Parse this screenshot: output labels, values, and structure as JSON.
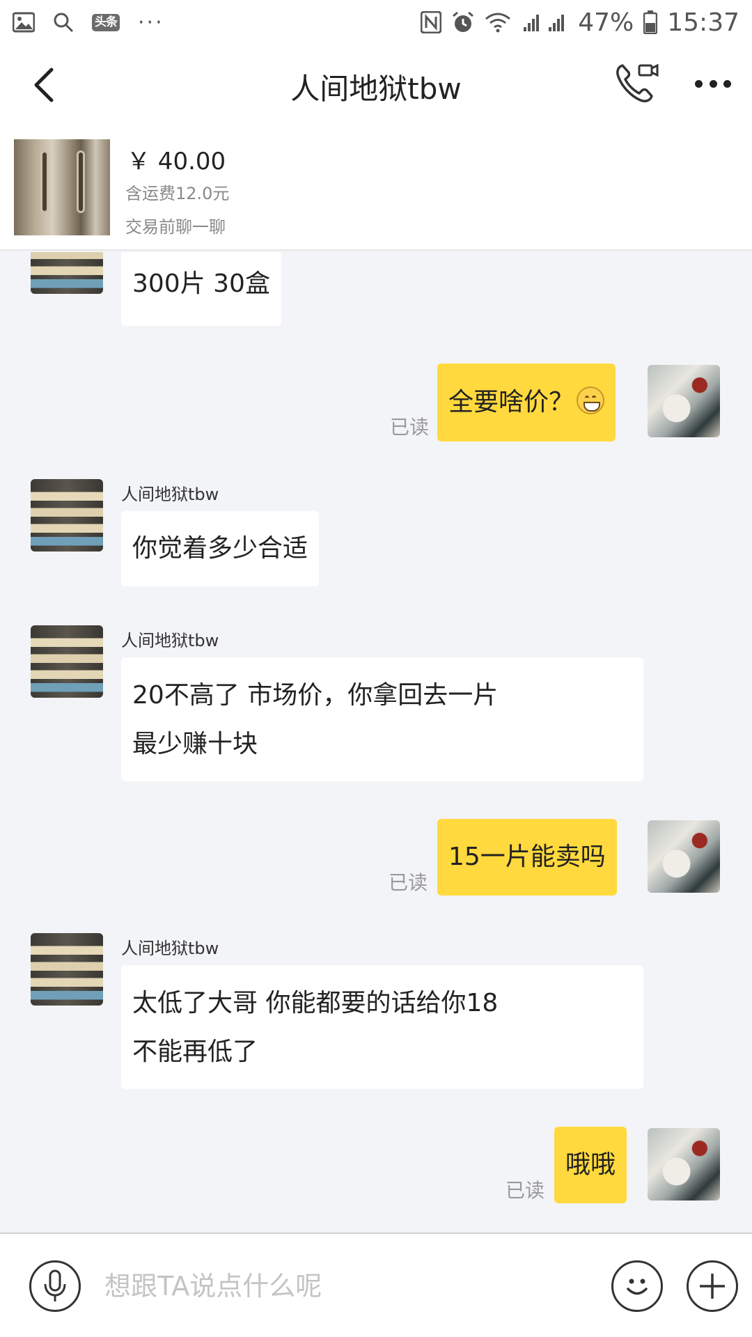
{
  "status_bar": {
    "toutiao_badge": "头条",
    "more_dots": "···",
    "battery_percent": "47%",
    "time": "15:37",
    "icons": [
      "gallery-icon",
      "search-icon",
      "nfc-icon",
      "alarm-icon",
      "wifi-icon",
      "signal-icon",
      "battery-icon"
    ]
  },
  "header": {
    "title": "人间地狱tbw"
  },
  "product": {
    "price": "￥ 40.00",
    "shipping": "含运费12.0元",
    "chat_prompt": "交易前聊一聊"
  },
  "messages": [
    {
      "from": "seller",
      "text": "300片 30盒"
    },
    {
      "from": "me",
      "text": "全要啥价？",
      "emoji": "grinning-face",
      "read": "已读"
    },
    {
      "from": "seller",
      "name": "人间地狱tbw",
      "text": "你觉着多少合适"
    },
    {
      "from": "seller",
      "name": "人间地狱tbw",
      "line1": "20不高了 市场价，你拿回去一片",
      "line2": "最少赚十块"
    },
    {
      "from": "me",
      "text": "15一片能卖吗",
      "read": "已读"
    },
    {
      "from": "seller",
      "name": "人间地狱tbw",
      "line1": "太低了大哥 你能都要的话给你18",
      "line2": "不能再低了"
    },
    {
      "from": "me",
      "text": "哦哦",
      "read": "已读"
    }
  ],
  "input": {
    "placeholder": "想跟TA说点什么呢",
    "value": ""
  },
  "colors": {
    "outgoing_bubble": "#ffd93d",
    "incoming_bubble": "#ffffff",
    "chat_background": "#f3f4f7"
  }
}
